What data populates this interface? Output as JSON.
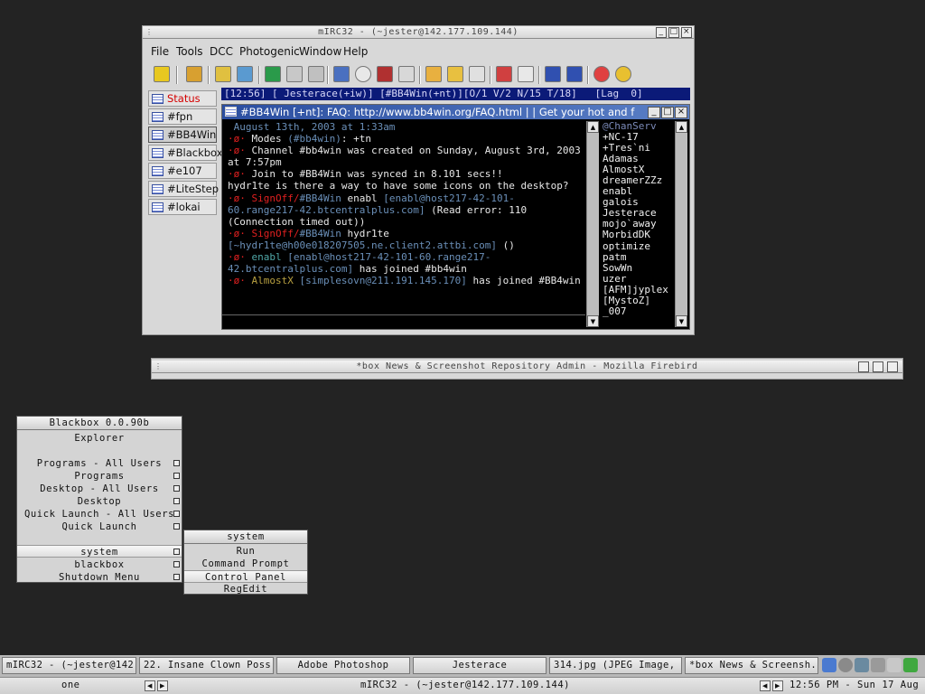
{
  "mirc": {
    "title": "mIRC32 - (~jester@142.177.109.144)",
    "menu": [
      "File",
      "Tools",
      "DCC",
      "Photogenic",
      "Window",
      "Help"
    ],
    "switchbar": [
      "Status",
      "#fpn",
      "#BB4Win",
      "#Blackbox",
      "#e107",
      "#LiteStep",
      "#lokai"
    ],
    "statusline": "[12:56] [ Jesterace(+iw)] [#BB4Win(+nt)][O/1 V/2 N/15 T/18]   [Lag  0]",
    "channel_title": "#BB4Win [+nt]: FAQ: http://www.bb4win.org/FAQ.html  | | Get your hot and f",
    "chat": {
      "l1": "August 13th, 2003 at 1:33am",
      "l2": {
        "bullet": "·ø·",
        "text": "Modes ",
        "chan": "(#bb4win)",
        "rest": ": +tn"
      },
      "l3": {
        "bullet": "·ø·",
        "text": "Channel #bb4win was created on Sunday, August 3rd, 2003 at 7:57pm"
      },
      "l4": {
        "bullet": "·ø·",
        "text": "Join to #BB4Win was synced in 8.101 secs!!"
      },
      "l5": {
        "nick": "hydr1te",
        "text": " is there a way to have some icons on the desktop?"
      },
      "l6": {
        "bullet": "·ø·",
        "action": "SignOff/",
        "chan": "#BB4Win",
        "nick": " enabl ",
        "host": "[enabl@host217-42-101-60.range217-42.btcentralplus.com]",
        "rest": " (Read error: 110 (Connection timed out))"
      },
      "l7": {
        "bullet": "·ø·",
        "action": "SignOff/",
        "chan": "#BB4Win",
        "nick": " hydr1te ",
        "host": "[~hydr1te@h00e018207505.ne.client2.attbi.com]",
        "rest": " ()"
      },
      "l8": {
        "bullet": "·ø·",
        "nick": "enabl",
        "host": " [enabl@host217-42-101-60.range217-42.btcentralplus.com]",
        "rest": " has joined #bb4win"
      },
      "l9": {
        "bullet": "·ø·",
        "nick": "AlmostX",
        "host": " [simplesovn@211.191.145.170]",
        "rest": " has joined #BB4win"
      }
    },
    "nicks": [
      "@ChanServ",
      "+NC-17",
      "+Tres`ni",
      "Adamas",
      "AlmostX",
      "dreamerZZz",
      "enabl",
      "galois",
      "Jesterace",
      "mojo`away",
      "MorbidDK",
      "optimize",
      "patm",
      "SowWn",
      "uzer",
      "[AFM]jyplex",
      "[MystoZ]",
      "_007"
    ]
  },
  "firebird": {
    "title": "*box News & Screenshot Repository Admin - Mozilla Firebird"
  },
  "bbmenu": {
    "title": "Blackbox 0.0.90b",
    "items": [
      "Explorer",
      "Programs - All Users",
      "Programs",
      "Desktop - All Users",
      "Desktop",
      "Quick Launch - All Users",
      "Quick Launch",
      "system",
      "blackbox",
      "Shutdown Menu"
    ]
  },
  "submenu": {
    "title": "system",
    "items": [
      "Run",
      "Command Prompt",
      "Control Panel",
      "RegEdit"
    ]
  },
  "taskbar": {
    "tasks": [
      "mIRC32 - (~jester@142....",
      "22. Insane Clown Poss...",
      "Adobe Photoshop",
      "Jesterace",
      "314.jpg (JPEG Image, 111...",
      "*box News & Screensh..."
    ],
    "workspace": "one",
    "active_window": "mIRC32 - (~jester@142.177.109.144)",
    "clock": "12:56 PM - Sun 17 Aug"
  },
  "colors": {
    "desktop": "#232323",
    "titlebar_blue": "#2b4ea0",
    "status_red": "#d40000",
    "bullet_red": "#e02020"
  },
  "icons": [
    "grip-icon",
    "minimize-icon",
    "maximize-icon",
    "close-icon",
    "channel-icon",
    "scroll-up-icon",
    "scroll-down-icon",
    "arrow-left-icon",
    "arrow-right-icon",
    "tray-icon"
  ]
}
